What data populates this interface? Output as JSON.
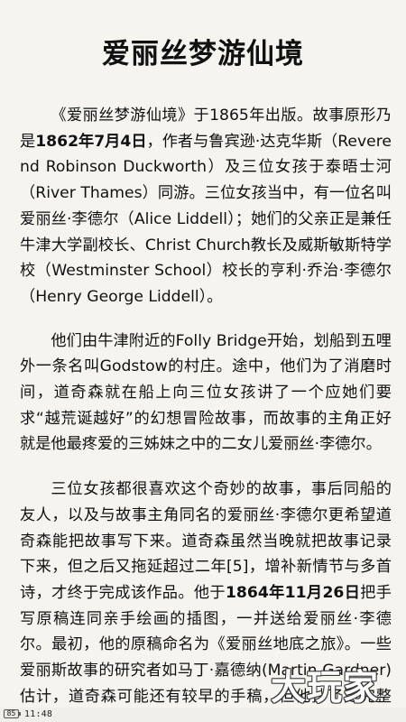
{
  "document": {
    "title": "爱丽丝梦游仙境",
    "paragraphs": [
      {
        "before_1": "《爱丽丝梦游仙境》于1865年出版。故事原形乃是",
        "bold_1": "1862年7月4日",
        "after_1": "，作者与鲁宾逊·达克华斯（Reverend Robinson Duckworth）及三位女孩于泰晤士河（River Thames）同游。三位女孩当中，有一位名叫爱丽丝·李德尔（Alice Liddell）；她们的父亲正是兼任牛津大学副校长、Christ Church教长及威斯敏斯特学校（Westminster School）校长的亨利·乔治·李德尔（Henry George Liddell）。"
      },
      {
        "text": "他们由牛津附近的Folly Bridge开始，划船到五哩外一条名叫Godstow的村庄。途中，他们为了消磨时间，道奇森就在船上向三位女孩讲了一个应她们要求“越荒诞越好”的幻想冒险故事，而故事的主角正好就是他最疼爱的三姊妹之中的二女儿爱丽丝·李德尔。"
      },
      {
        "before_1": "三位女孩都很喜欢这个奇妙的故事，事后同船的友人，以及与故事主角同名的爱丽丝·李德尔更希望道奇森能把故事写下来。道奇森虽然当晚就把故事记录下来，但之后又拖延超过二年[5]，增补新情节与多首诗，才终于完成该作品。他于",
        "bold_1": "1864年11月26日",
        "after_1": "把手写原稿连同亲手绘画的插图，一并送给爱丽丝·李德尔。最初，他的原稿命名为《爱丽丝地底之旅》。一些爱丽斯故事的研究者如马丁·嘉德纳(Martin Gardner)估计，道奇森可能还有较早的手稿，但他抄了更完整的版本之后，便将初稿毁掉。不过，此推断"
      }
    ]
  },
  "watermark": {
    "text": "大玩家"
  },
  "status_bar": {
    "battery": "85",
    "time": "11:48"
  }
}
